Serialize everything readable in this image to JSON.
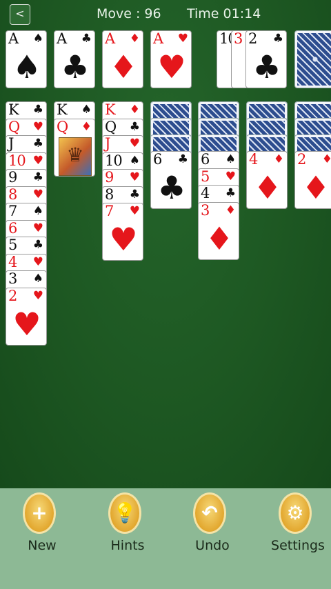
{
  "header": {
    "back_label": "<",
    "move_text": "Move : 96",
    "time_text": "Time 01:14"
  },
  "foundations": [
    {
      "rank": "A",
      "suit": "♠",
      "color": "black"
    },
    {
      "rank": "A",
      "suit": "♣",
      "color": "black"
    },
    {
      "rank": "A",
      "suit": "♦",
      "color": "red"
    },
    {
      "rank": "A",
      "suit": "♥",
      "color": "red"
    }
  ],
  "waste": [
    {
      "rank": "10",
      "suit": "♣",
      "color": "black"
    },
    {
      "rank": "3",
      "suit": "♥",
      "color": "red"
    },
    {
      "rank": "2",
      "suit": "♣",
      "color": "black"
    }
  ],
  "stock": {
    "face_down": true
  },
  "tableau": [
    {
      "hidden": 0,
      "cards": [
        {
          "rank": "K",
          "suit": "♣",
          "color": "black"
        },
        {
          "rank": "Q",
          "suit": "♥",
          "color": "red"
        },
        {
          "rank": "J",
          "suit": "♣",
          "color": "black"
        },
        {
          "rank": "10",
          "suit": "♥",
          "color": "red"
        },
        {
          "rank": "9",
          "suit": "♣",
          "color": "black"
        },
        {
          "rank": "8",
          "suit": "♥",
          "color": "red"
        },
        {
          "rank": "7",
          "suit": "♠",
          "color": "black"
        },
        {
          "rank": "6",
          "suit": "♥",
          "color": "red"
        },
        {
          "rank": "5",
          "suit": "♣",
          "color": "black"
        },
        {
          "rank": "4",
          "suit": "♥",
          "color": "red"
        },
        {
          "rank": "3",
          "suit": "♠",
          "color": "black"
        },
        {
          "rank": "2",
          "suit": "♥",
          "color": "red"
        }
      ]
    },
    {
      "hidden": 0,
      "cards": [
        {
          "rank": "K",
          "suit": "♠",
          "color": "black"
        },
        {
          "rank": "Q",
          "suit": "♦",
          "color": "red",
          "face": "queen-portrait"
        }
      ]
    },
    {
      "hidden": 0,
      "cards": [
        {
          "rank": "K",
          "suit": "♦",
          "color": "red"
        },
        {
          "rank": "Q",
          "suit": "♣",
          "color": "black"
        },
        {
          "rank": "J",
          "suit": "♥",
          "color": "red"
        },
        {
          "rank": "10",
          "suit": "♠",
          "color": "black"
        },
        {
          "rank": "9",
          "suit": "♥",
          "color": "red"
        },
        {
          "rank": "8",
          "suit": "♣",
          "color": "black"
        },
        {
          "rank": "7",
          "suit": "♥",
          "color": "red"
        }
      ]
    },
    {
      "hidden": 3,
      "cards": [
        {
          "rank": "6",
          "suit": "♣",
          "color": "black"
        }
      ]
    },
    {
      "hidden": 3,
      "cards": [
        {
          "rank": "6",
          "suit": "♠",
          "color": "black"
        },
        {
          "rank": "5",
          "suit": "♥",
          "color": "red"
        },
        {
          "rank": "4",
          "suit": "♣",
          "color": "black"
        },
        {
          "rank": "3",
          "suit": "♦",
          "color": "red"
        }
      ]
    },
    {
      "hidden": 3,
      "cards": [
        {
          "rank": "4",
          "suit": "♦",
          "color": "red"
        }
      ]
    },
    {
      "hidden": 3,
      "cards": [
        {
          "rank": "2",
          "suit": "♦",
          "color": "red"
        }
      ]
    }
  ],
  "toolbar": [
    {
      "id": "new",
      "label": "New",
      "icon": "plus-icon",
      "glyph": "+"
    },
    {
      "id": "hints",
      "label": "Hints",
      "icon": "lightbulb-icon",
      "glyph": "💡"
    },
    {
      "id": "undo",
      "label": "Undo",
      "icon": "undo-arrow-icon",
      "glyph": "↶"
    },
    {
      "id": "settings",
      "label": "Settings",
      "icon": "gear-icon",
      "glyph": "⚙"
    }
  ],
  "colors": {
    "felt": "#1d5722",
    "toolbar_bg": "#8db995",
    "red_suit": "#e5161b",
    "gold_button": "#e1a42a"
  }
}
